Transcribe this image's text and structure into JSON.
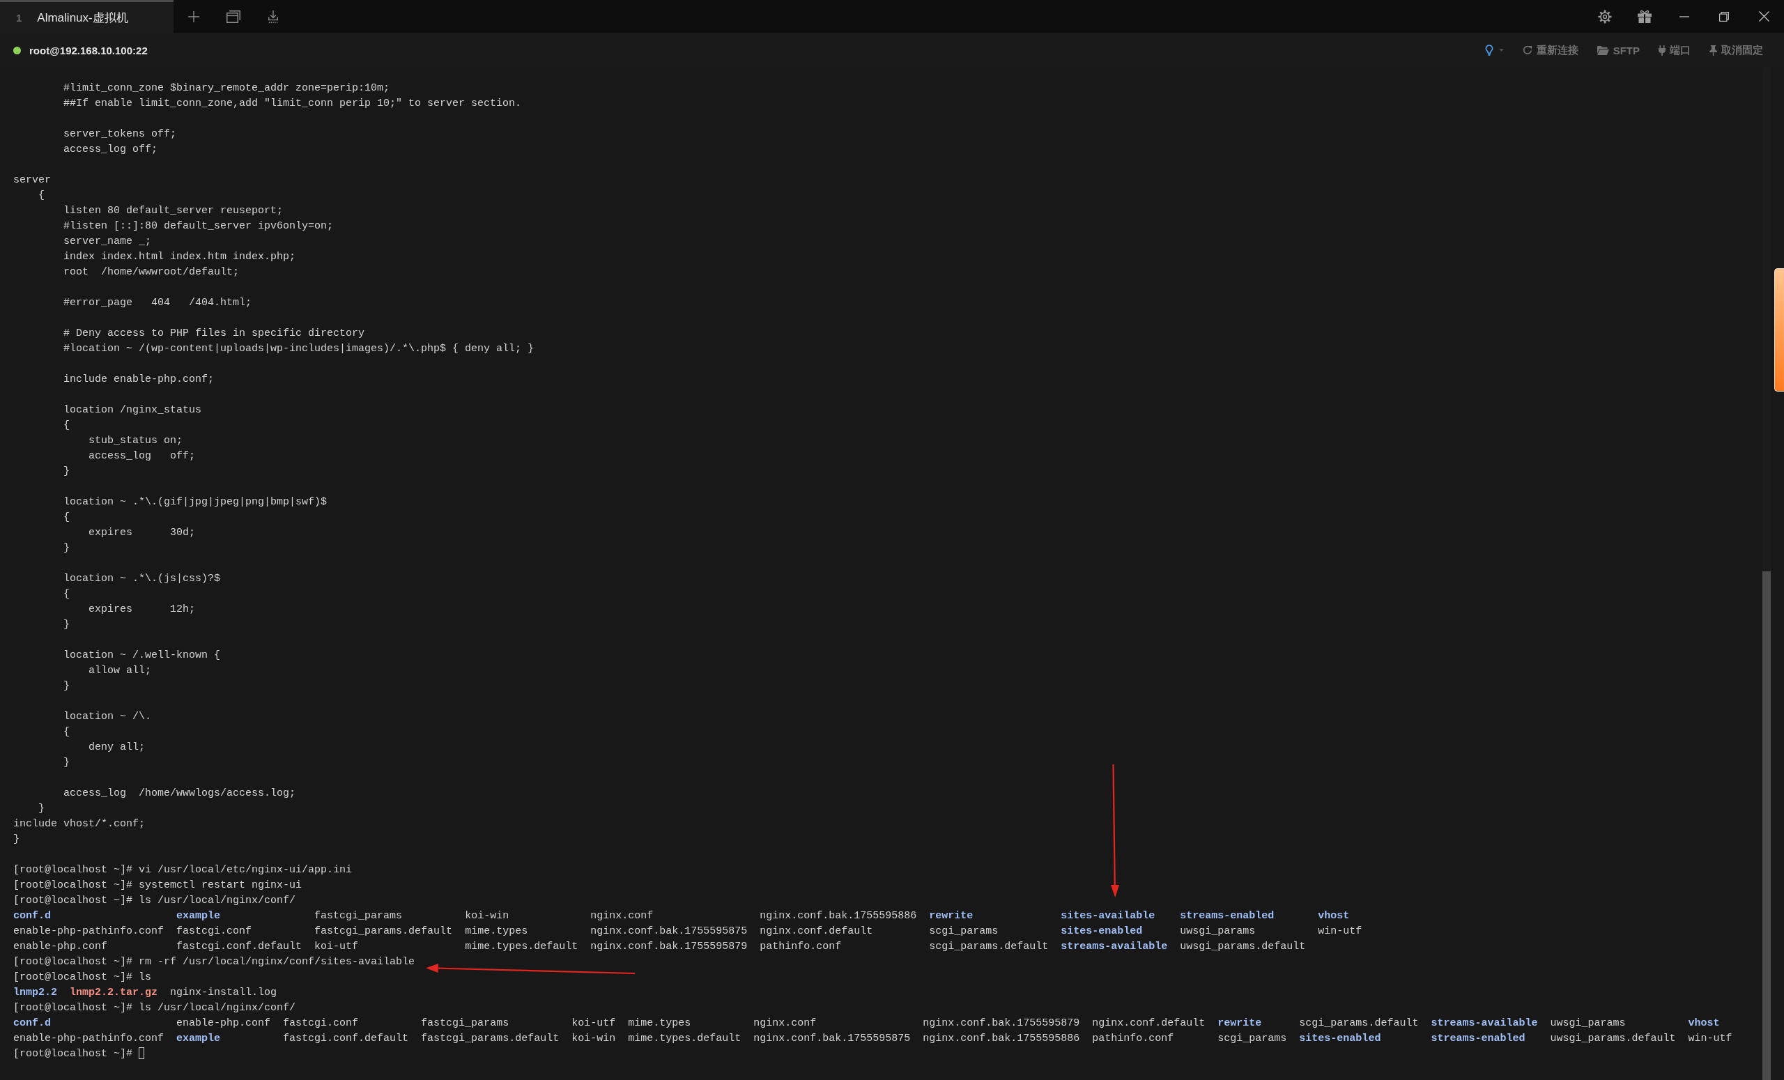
{
  "tab_bar": {
    "tabs": [
      {
        "number": "1",
        "title": "Almalinux-虚拟机",
        "selected": true
      }
    ]
  },
  "session_bar": {
    "connection": "root@192.168.10.100:22",
    "connected": true,
    "actions": [
      {
        "kind": "hint"
      },
      {
        "kind": "reconnect",
        "label": "重新连接"
      },
      {
        "kind": "sftp",
        "label": "SFTP"
      },
      {
        "kind": "ports",
        "label": "端口"
      },
      {
        "kind": "unpin",
        "label": "取消固定"
      }
    ]
  },
  "terminal": {
    "lines": [
      {
        "kind": "text",
        "text": "        #limit_conn_zone $binary_remote_addr zone=perip:10m;"
      },
      {
        "kind": "text",
        "text": "        ##If enable limit_conn_zone,add \"limit_conn perip 10;\" to server section."
      },
      {
        "kind": "blank"
      },
      {
        "kind": "text",
        "text": "        server_tokens off;"
      },
      {
        "kind": "text",
        "text": "        access_log off;"
      },
      {
        "kind": "blank"
      },
      {
        "kind": "text",
        "text": "server"
      },
      {
        "kind": "text",
        "text": "    {"
      },
      {
        "kind": "text",
        "text": "        listen 80 default_server reuseport;"
      },
      {
        "kind": "text",
        "text": "        #listen [::]:80 default_server ipv6only=on;"
      },
      {
        "kind": "text",
        "text": "        server_name _;"
      },
      {
        "kind": "text",
        "text": "        index index.html index.htm index.php;"
      },
      {
        "kind": "text",
        "text": "        root  /home/wwwroot/default;"
      },
      {
        "kind": "blank"
      },
      {
        "kind": "text",
        "text": "        #error_page   404   /404.html;"
      },
      {
        "kind": "blank"
      },
      {
        "kind": "text",
        "text": "        # Deny access to PHP files in specific directory"
      },
      {
        "kind": "text",
        "text": "        #location ~ /(wp-content|uploads|wp-includes|images)/.*\\.php$ { deny all; }"
      },
      {
        "kind": "blank"
      },
      {
        "kind": "text",
        "text": "        include enable-php.conf;"
      },
      {
        "kind": "blank"
      },
      {
        "kind": "text",
        "text": "        location /nginx_status"
      },
      {
        "kind": "text",
        "text": "        {"
      },
      {
        "kind": "text",
        "text": "            stub_status on;"
      },
      {
        "kind": "text",
        "text": "            access_log   off;"
      },
      {
        "kind": "text",
        "text": "        }"
      },
      {
        "kind": "blank"
      },
      {
        "kind": "text",
        "text": "        location ~ .*\\.(gif|jpg|jpeg|png|bmp|swf)$"
      },
      {
        "kind": "text",
        "text": "        {"
      },
      {
        "kind": "text",
        "text": "            expires      30d;"
      },
      {
        "kind": "text",
        "text": "        }"
      },
      {
        "kind": "blank"
      },
      {
        "kind": "text",
        "text": "        location ~ .*\\.(js|css)?$"
      },
      {
        "kind": "text",
        "text": "        {"
      },
      {
        "kind": "text",
        "text": "            expires      12h;"
      },
      {
        "kind": "text",
        "text": "        }"
      },
      {
        "kind": "blank"
      },
      {
        "kind": "text",
        "text": "        location ~ /.well-known {"
      },
      {
        "kind": "text",
        "text": "            allow all;"
      },
      {
        "kind": "text",
        "text": "        }"
      },
      {
        "kind": "blank"
      },
      {
        "kind": "text",
        "text": "        location ~ /\\."
      },
      {
        "kind": "text",
        "text": "        {"
      },
      {
        "kind": "text",
        "text": "            deny all;"
      },
      {
        "kind": "text",
        "text": "        }"
      },
      {
        "kind": "blank"
      },
      {
        "kind": "text",
        "text": "        access_log  /home/wwwlogs/access.log;"
      },
      {
        "kind": "text",
        "text": "    }"
      },
      {
        "kind": "text",
        "text": "include vhost/*.conf;"
      },
      {
        "kind": "text",
        "text": "}"
      },
      {
        "kind": "blank"
      },
      {
        "kind": "text",
        "text": "[root@localhost ~]# vi /usr/local/etc/nginx-ui/app.ini"
      },
      {
        "kind": "text",
        "text": "[root@localhost ~]# systemctl restart nginx-ui"
      },
      {
        "kind": "text",
        "text": "[root@localhost ~]# ls /usr/local/nginx/conf/"
      },
      {
        "kind": "listing",
        "rows": [
          [
            {
              "name": "conf.d",
              "kind": "dir"
            },
            {
              "name": "example",
              "kind": "dir"
            },
            {
              "name": "fastcgi_params",
              "kind": "file"
            },
            {
              "name": "koi-win",
              "kind": "file"
            },
            {
              "name": "nginx.conf",
              "kind": "file"
            },
            {
              "name": "nginx.conf.bak.1755595886",
              "kind": "file"
            },
            {
              "name": "rewrite",
              "kind": "dir"
            },
            {
              "name": "sites-available",
              "kind": "dir"
            },
            {
              "name": "streams-enabled",
              "kind": "dir"
            },
            {
              "name": "vhost",
              "kind": "dir"
            }
          ],
          [
            {
              "name": "enable-php-pathinfo.conf",
              "kind": "file"
            },
            {
              "name": "fastcgi.conf",
              "kind": "file"
            },
            {
              "name": "fastcgi_params.default",
              "kind": "file"
            },
            {
              "name": "mime.types",
              "kind": "file"
            },
            {
              "name": "nginx.conf.bak.1755595875",
              "kind": "file"
            },
            {
              "name": "nginx.conf.default",
              "kind": "file"
            },
            {
              "name": "scgi_params",
              "kind": "file"
            },
            {
              "name": "sites-enabled",
              "kind": "dir"
            },
            {
              "name": "uwsgi_params",
              "kind": "file"
            },
            {
              "name": "win-utf",
              "kind": "file"
            }
          ],
          [
            {
              "name": "enable-php.conf",
              "kind": "file"
            },
            {
              "name": "fastcgi.conf.default",
              "kind": "file"
            },
            {
              "name": "koi-utf",
              "kind": "file"
            },
            {
              "name": "mime.types.default",
              "kind": "file"
            },
            {
              "name": "nginx.conf.bak.1755595879",
              "kind": "file"
            },
            {
              "name": "pathinfo.conf",
              "kind": "file"
            },
            {
              "name": "scgi_params.default",
              "kind": "file"
            },
            {
              "name": "streams-available",
              "kind": "dir"
            },
            {
              "name": "uwsgi_params.default",
              "kind": "file"
            }
          ]
        ]
      },
      {
        "kind": "text",
        "text": "[root@localhost ~]# rm -rf /usr/local/nginx/conf/sites-available"
      },
      {
        "kind": "text",
        "text": "[root@localhost ~]# ls"
      },
      {
        "kind": "listing",
        "rows": [
          [
            {
              "name": "lnmp2.2",
              "kind": "dir"
            },
            {
              "name": "lnmp2.2.tar.gz",
              "kind": "archive"
            },
            {
              "name": "nginx-install.log",
              "kind": "file"
            }
          ]
        ]
      },
      {
        "kind": "text",
        "text": "[root@localhost ~]# ls /usr/local/nginx/conf/"
      },
      {
        "kind": "listing",
        "rows": [
          [
            {
              "name": "conf.d",
              "kind": "dir"
            },
            {
              "name": "enable-php.conf",
              "kind": "file"
            },
            {
              "name": "fastcgi.conf",
              "kind": "file"
            },
            {
              "name": "fastcgi_params",
              "kind": "file"
            },
            {
              "name": "koi-utf",
              "kind": "file"
            },
            {
              "name": "mime.types",
              "kind": "file"
            },
            {
              "name": "nginx.conf",
              "kind": "file"
            },
            {
              "name": "nginx.conf.bak.1755595879",
              "kind": "file"
            },
            {
              "name": "nginx.conf.default",
              "kind": "file"
            },
            {
              "name": "rewrite",
              "kind": "dir"
            },
            {
              "name": "scgi_params.default",
              "kind": "file"
            },
            {
              "name": "streams-available",
              "kind": "dir"
            },
            {
              "name": "uwsgi_params",
              "kind": "file"
            },
            {
              "name": "vhost",
              "kind": "dir"
            }
          ],
          [
            {
              "name": "enable-php-pathinfo.conf",
              "kind": "file"
            },
            {
              "name": "example",
              "kind": "dir"
            },
            {
              "name": "fastcgi.conf.default",
              "kind": "file"
            },
            {
              "name": "fastcgi_params.default",
              "kind": "file"
            },
            {
              "name": "koi-win",
              "kind": "file"
            },
            {
              "name": "mime.types.default",
              "kind": "file"
            },
            {
              "name": "nginx.conf.bak.1755595875",
              "kind": "file"
            },
            {
              "name": "nginx.conf.bak.1755595886",
              "kind": "file"
            },
            {
              "name": "pathinfo.conf",
              "kind": "file"
            },
            {
              "name": "scgi_params",
              "kind": "file"
            },
            {
              "name": "sites-enabled",
              "kind": "dir"
            },
            {
              "name": "streams-enabled",
              "kind": "dir"
            },
            {
              "name": "uwsgi_params.default",
              "kind": "file"
            },
            {
              "name": "win-utf",
              "kind": "file"
            }
          ]
        ]
      },
      {
        "kind": "input",
        "prompt": "[root@localhost ~]#"
      }
    ]
  }
}
